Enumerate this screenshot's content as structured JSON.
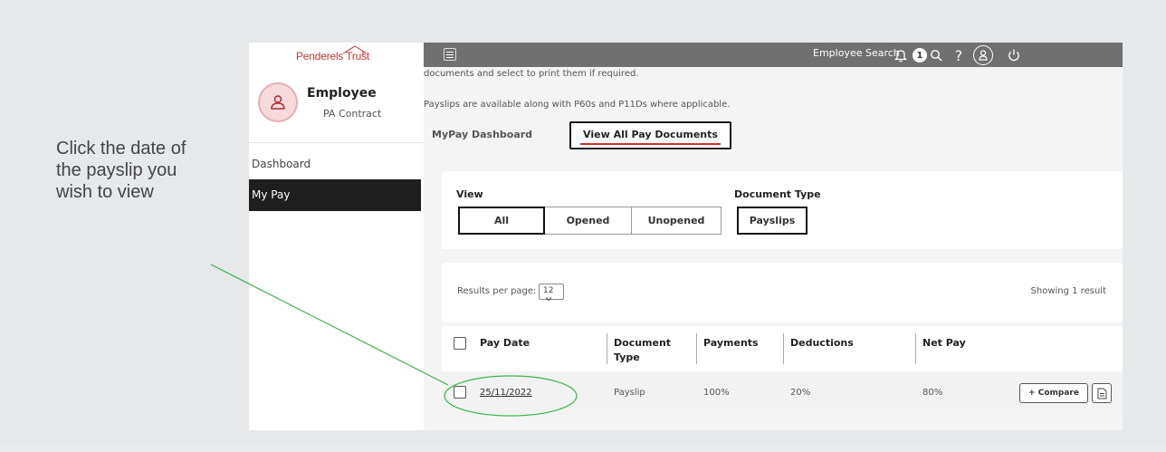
{
  "annotation": {
    "instruction": "Click the date of the payslip you wish to view",
    "color": "#3cb44b"
  },
  "brand": {
    "logo": "Penderels Trust",
    "color": "#c2373b"
  },
  "user": {
    "name": "Employee",
    "role": "PA Contract"
  },
  "sidebar": {
    "items": [
      {
        "label": "Dashboard"
      },
      {
        "label": "My Pay"
      }
    ]
  },
  "topbar": {
    "search_label": "Employee Search",
    "notification_count": "1",
    "help": "?"
  },
  "intro": {
    "line1": "documents and select to print them if required.",
    "line2": "Payslips are available along with P60s and P11Ds where applicable."
  },
  "tabs": [
    {
      "label": "MyPay Dashboard"
    },
    {
      "label": "View All Pay Documents"
    }
  ],
  "filters": {
    "view_label": "View",
    "view_options": [
      "All",
      "Opened",
      "Unopened"
    ],
    "doctype_label": "Document Type",
    "doctype_value": "Payslips"
  },
  "results": {
    "per_page_label": "Results per page:",
    "per_page_value": "12",
    "showing": "Showing 1 result"
  },
  "table": {
    "columns": [
      "Pay Date",
      "Document Type",
      "Payments",
      "Deductions",
      "Net Pay"
    ],
    "rows": [
      {
        "pay_date": "25/11/2022",
        "document_type": "Payslip",
        "payments": "100%",
        "deductions": "20%",
        "net_pay": "80%",
        "compare": "+ Compare"
      }
    ]
  }
}
